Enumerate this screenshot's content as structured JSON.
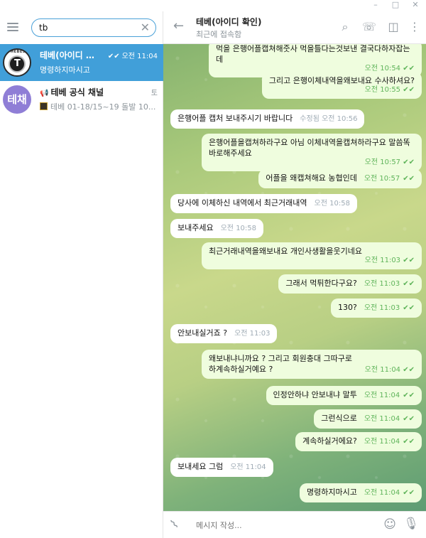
{
  "window": {
    "minimize": "–",
    "maximize": "□",
    "close": "✕"
  },
  "search": {
    "value": "tb",
    "clear_label": "✕"
  },
  "chats": [
    {
      "title": "테베(아이디 …",
      "time": "오전 11:04",
      "preview": "명령하지마시고",
      "checks": "✔✔",
      "avatar_text": "T",
      "avatar_top": "THEBES"
    },
    {
      "title": "테베 공식 채널",
      "time": "토",
      "preview": "테베 01-18/15~19 돌발 10...",
      "avatar_text": "테채",
      "icon": "📢"
    }
  ],
  "header": {
    "title": "테베(아이디 확인)",
    "status": "최근에 접속함"
  },
  "messages": [
    {
      "dir": "out",
      "text": "먹을 은행어플캡쳐해줏사 먹을틀다는것보낸 결국다하자잡는데",
      "time": "오전 10:54",
      "checks": "✔✔"
    },
    {
      "dir": "out",
      "text": "그리고 은행이체내역을왜보내요 수사하셔요?",
      "time": "오전 10:55",
      "checks": "✔✔"
    },
    {
      "dir": "in",
      "text": "은행어플 캡처 보내주시기 바랍니다",
      "time": "수정됨 오전 10:56"
    },
    {
      "dir": "out",
      "text": "은행어플을캡쳐하라구요 아님 이체내역을캡쳐하라구요 말씀똑바로해주세요",
      "time": "오전 10:57",
      "checks": "✔✔"
    },
    {
      "dir": "out",
      "text": "어플을 왜캡쳐해요 농협인데",
      "time": "오전 10:57",
      "checks": "✔✔"
    },
    {
      "dir": "in",
      "text": "당사에 이체하신 내역에서 최근거래내역",
      "time": "오전 10:58"
    },
    {
      "dir": "in",
      "text": "보내주세요",
      "time": "오전 10:58"
    },
    {
      "dir": "out",
      "text": "최근거래내역을왜보내요 개인사생활을웃기네요",
      "time": "오전 11:03",
      "checks": "✔✔"
    },
    {
      "dir": "out",
      "text": "그래서 먹튀한다구요?",
      "time": "오전 11:03",
      "checks": "✔✔"
    },
    {
      "dir": "out",
      "text": "130?",
      "time": "오전 11:03",
      "checks": "✔✔"
    },
    {
      "dir": "in",
      "text": "안보내실거죠 ?",
      "time": "오전 11:03"
    },
    {
      "dir": "out",
      "text": "왜보내냐니까요 ? 그리고 회원충대 그따구로하계속하실거예요 ?",
      "time": "오전 11:04",
      "checks": "✔✔"
    },
    {
      "dir": "out",
      "text": "인정안하냐 안보내냐 말투",
      "time": "오전 11:04",
      "checks": "✔✔"
    },
    {
      "dir": "out",
      "text": "그런식으로",
      "time": "오전 11:04",
      "checks": "✔✔"
    },
    {
      "dir": "out",
      "text": "계속하실거에요?",
      "time": "오전 11:04",
      "checks": "✔✔"
    },
    {
      "dir": "in",
      "text": "보내세요 그럼",
      "time": "오전 11:04"
    },
    {
      "dir": "out",
      "text": "명령하지마시고",
      "time": "오전 11:04",
      "checks": "✔✔"
    }
  ],
  "composer": {
    "placeholder": "메시지 작성..."
  },
  "icons": {
    "menu": "hamburger-menu-icon",
    "back": "back-arrow-icon",
    "search": "search-icon",
    "call": "phone-icon",
    "sidebar": "sidebar-toggle-icon",
    "more": "more-vertical-icon",
    "attach": "paperclip-icon",
    "emoji": "emoji-icon",
    "mic": "microphone-icon"
  },
  "colors": {
    "accent": "#419fd9",
    "out_bubble": "#effdde",
    "check": "#5fb45a"
  }
}
